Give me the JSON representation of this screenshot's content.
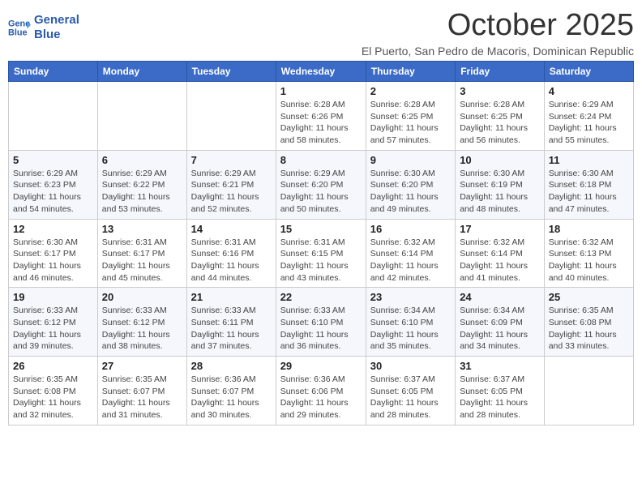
{
  "logo": {
    "line1": "General",
    "line2": "Blue"
  },
  "title": "October 2025",
  "subtitle": "El Puerto, San Pedro de Macoris, Dominican Republic",
  "days_header": [
    "Sunday",
    "Monday",
    "Tuesday",
    "Wednesday",
    "Thursday",
    "Friday",
    "Saturday"
  ],
  "weeks": [
    [
      {
        "day": "",
        "info": ""
      },
      {
        "day": "",
        "info": ""
      },
      {
        "day": "",
        "info": ""
      },
      {
        "day": "1",
        "info": "Sunrise: 6:28 AM\nSunset: 6:26 PM\nDaylight: 11 hours\nand 58 minutes."
      },
      {
        "day": "2",
        "info": "Sunrise: 6:28 AM\nSunset: 6:25 PM\nDaylight: 11 hours\nand 57 minutes."
      },
      {
        "day": "3",
        "info": "Sunrise: 6:28 AM\nSunset: 6:25 PM\nDaylight: 11 hours\nand 56 minutes."
      },
      {
        "day": "4",
        "info": "Sunrise: 6:29 AM\nSunset: 6:24 PM\nDaylight: 11 hours\nand 55 minutes."
      }
    ],
    [
      {
        "day": "5",
        "info": "Sunrise: 6:29 AM\nSunset: 6:23 PM\nDaylight: 11 hours\nand 54 minutes."
      },
      {
        "day": "6",
        "info": "Sunrise: 6:29 AM\nSunset: 6:22 PM\nDaylight: 11 hours\nand 53 minutes."
      },
      {
        "day": "7",
        "info": "Sunrise: 6:29 AM\nSunset: 6:21 PM\nDaylight: 11 hours\nand 52 minutes."
      },
      {
        "day": "8",
        "info": "Sunrise: 6:29 AM\nSunset: 6:20 PM\nDaylight: 11 hours\nand 50 minutes."
      },
      {
        "day": "9",
        "info": "Sunrise: 6:30 AM\nSunset: 6:20 PM\nDaylight: 11 hours\nand 49 minutes."
      },
      {
        "day": "10",
        "info": "Sunrise: 6:30 AM\nSunset: 6:19 PM\nDaylight: 11 hours\nand 48 minutes."
      },
      {
        "day": "11",
        "info": "Sunrise: 6:30 AM\nSunset: 6:18 PM\nDaylight: 11 hours\nand 47 minutes."
      }
    ],
    [
      {
        "day": "12",
        "info": "Sunrise: 6:30 AM\nSunset: 6:17 PM\nDaylight: 11 hours\nand 46 minutes."
      },
      {
        "day": "13",
        "info": "Sunrise: 6:31 AM\nSunset: 6:17 PM\nDaylight: 11 hours\nand 45 minutes."
      },
      {
        "day": "14",
        "info": "Sunrise: 6:31 AM\nSunset: 6:16 PM\nDaylight: 11 hours\nand 44 minutes."
      },
      {
        "day": "15",
        "info": "Sunrise: 6:31 AM\nSunset: 6:15 PM\nDaylight: 11 hours\nand 43 minutes."
      },
      {
        "day": "16",
        "info": "Sunrise: 6:32 AM\nSunset: 6:14 PM\nDaylight: 11 hours\nand 42 minutes."
      },
      {
        "day": "17",
        "info": "Sunrise: 6:32 AM\nSunset: 6:14 PM\nDaylight: 11 hours\nand 41 minutes."
      },
      {
        "day": "18",
        "info": "Sunrise: 6:32 AM\nSunset: 6:13 PM\nDaylight: 11 hours\nand 40 minutes."
      }
    ],
    [
      {
        "day": "19",
        "info": "Sunrise: 6:33 AM\nSunset: 6:12 PM\nDaylight: 11 hours\nand 39 minutes."
      },
      {
        "day": "20",
        "info": "Sunrise: 6:33 AM\nSunset: 6:12 PM\nDaylight: 11 hours\nand 38 minutes."
      },
      {
        "day": "21",
        "info": "Sunrise: 6:33 AM\nSunset: 6:11 PM\nDaylight: 11 hours\nand 37 minutes."
      },
      {
        "day": "22",
        "info": "Sunrise: 6:33 AM\nSunset: 6:10 PM\nDaylight: 11 hours\nand 36 minutes."
      },
      {
        "day": "23",
        "info": "Sunrise: 6:34 AM\nSunset: 6:10 PM\nDaylight: 11 hours\nand 35 minutes."
      },
      {
        "day": "24",
        "info": "Sunrise: 6:34 AM\nSunset: 6:09 PM\nDaylight: 11 hours\nand 34 minutes."
      },
      {
        "day": "25",
        "info": "Sunrise: 6:35 AM\nSunset: 6:08 PM\nDaylight: 11 hours\nand 33 minutes."
      }
    ],
    [
      {
        "day": "26",
        "info": "Sunrise: 6:35 AM\nSunset: 6:08 PM\nDaylight: 11 hours\nand 32 minutes."
      },
      {
        "day": "27",
        "info": "Sunrise: 6:35 AM\nSunset: 6:07 PM\nDaylight: 11 hours\nand 31 minutes."
      },
      {
        "day": "28",
        "info": "Sunrise: 6:36 AM\nSunset: 6:07 PM\nDaylight: 11 hours\nand 30 minutes."
      },
      {
        "day": "29",
        "info": "Sunrise: 6:36 AM\nSunset: 6:06 PM\nDaylight: 11 hours\nand 29 minutes."
      },
      {
        "day": "30",
        "info": "Sunrise: 6:37 AM\nSunset: 6:05 PM\nDaylight: 11 hours\nand 28 minutes."
      },
      {
        "day": "31",
        "info": "Sunrise: 6:37 AM\nSunset: 6:05 PM\nDaylight: 11 hours\nand 28 minutes."
      },
      {
        "day": "",
        "info": ""
      }
    ]
  ]
}
